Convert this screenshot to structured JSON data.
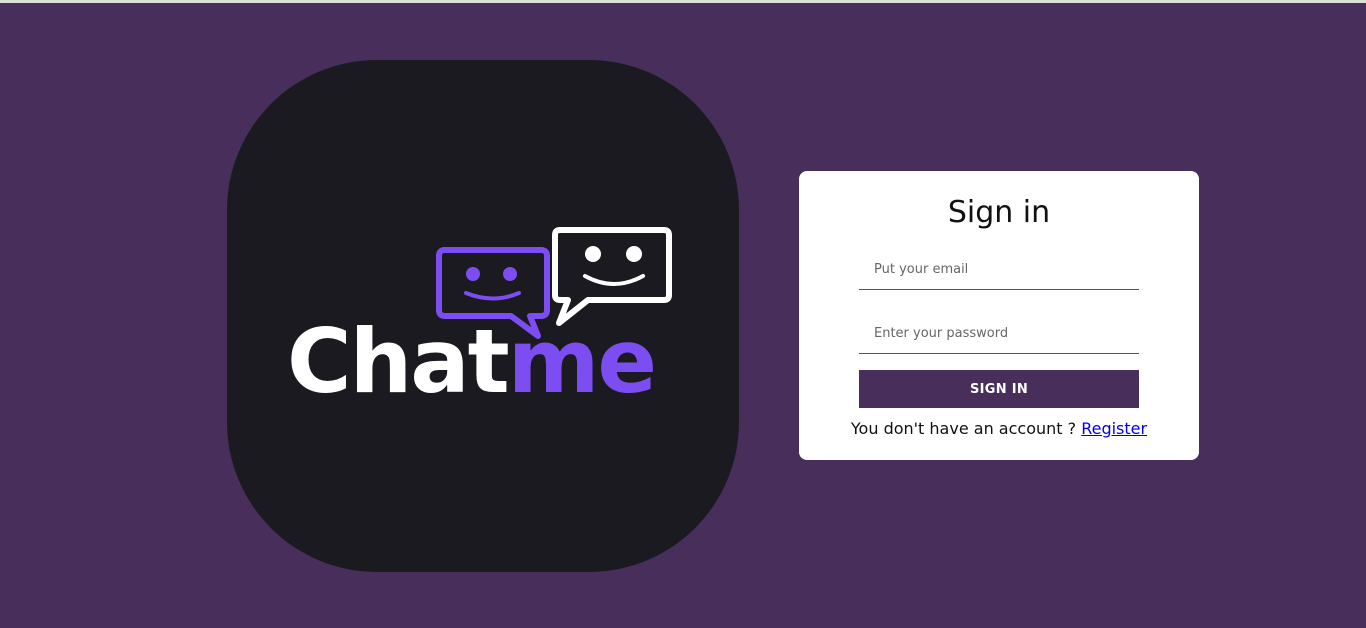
{
  "logo": {
    "word_part1": "Chat",
    "word_part2": "me",
    "colors": {
      "card_background": "#1b1a20",
      "accent": "#7c4ef2",
      "white": "#ffffff"
    },
    "icons": [
      "smiling-speech-bubble-icon",
      "smiling-speech-bubble-icon"
    ]
  },
  "signin": {
    "title": "Sign in",
    "email_placeholder": "Put your email",
    "password_placeholder": "Enter your password",
    "button_label": "SIGN IN",
    "register_prompt": "You don't have an account ? ",
    "register_link": "Register"
  },
  "colors": {
    "page_background": "#472e5b",
    "card_background": "#ffffff",
    "button_background": "#472e5b",
    "link": "#0000ee"
  }
}
